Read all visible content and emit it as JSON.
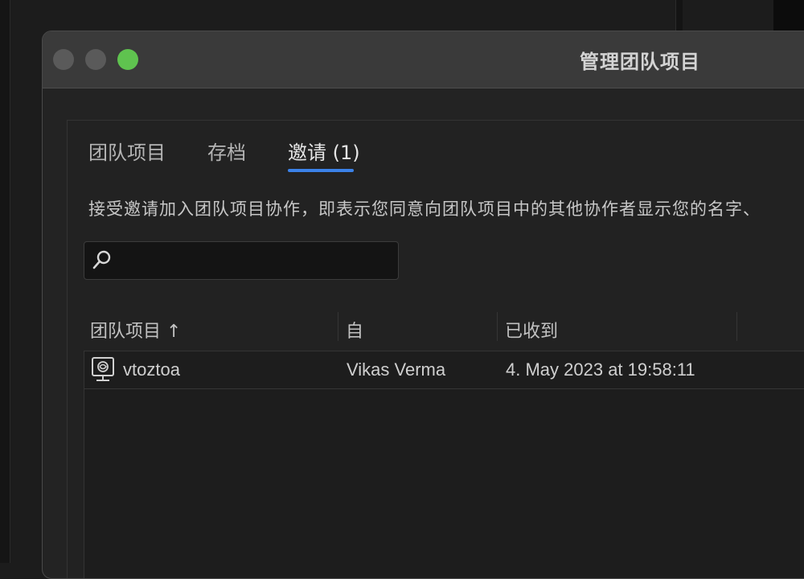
{
  "window": {
    "title": "管理团队项目"
  },
  "tabs": [
    {
      "label": "团队项目",
      "active": false
    },
    {
      "label": "存档",
      "active": false
    },
    {
      "label": "邀请 (1)",
      "active": true
    }
  ],
  "description": "接受邀请加入团队项目协作，即表示您同意向团队项目中的其他协作者显示您的名字、",
  "search": {
    "value": "",
    "placeholder": ""
  },
  "table": {
    "columns": [
      {
        "label": "团队项目 ↑"
      },
      {
        "label": "自"
      },
      {
        "label": "已收到"
      }
    ],
    "rows": [
      {
        "icon": "team-project-icon",
        "name": "vtoztoa",
        "from": "Vikas Verma",
        "received": "4. May 2023 at 19:58:11"
      }
    ]
  },
  "colors": {
    "accent": "#3b82e8",
    "zoom_button": "#5fc34f",
    "dialog_bg": "#232323",
    "titlebar_bg": "#3a3a3a"
  }
}
